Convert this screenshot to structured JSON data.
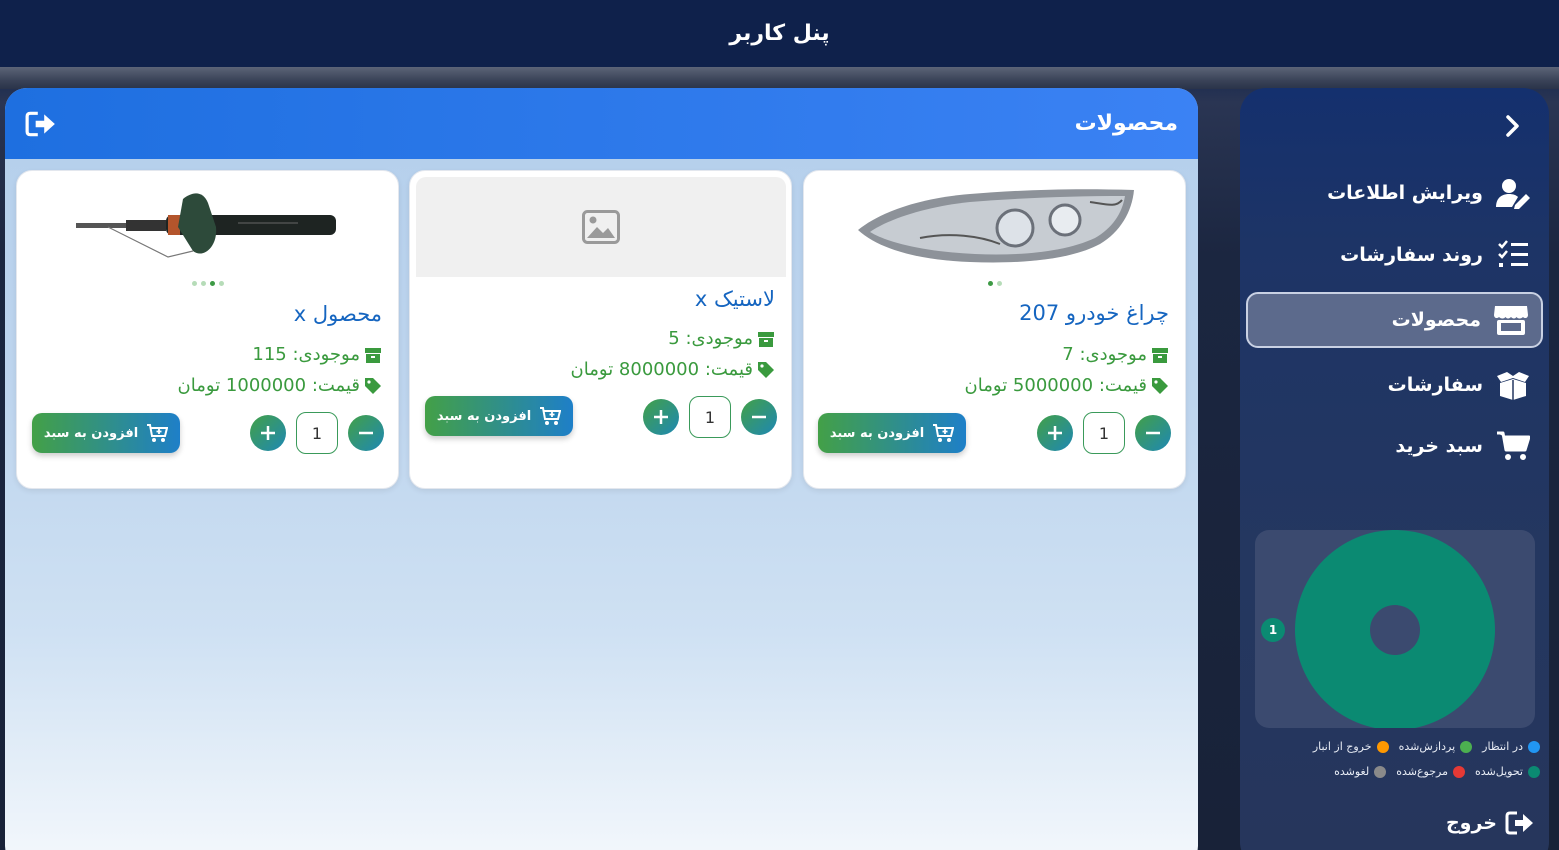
{
  "header": {
    "title": "پنل کاربر"
  },
  "sidebar": {
    "items": [
      {
        "label": "ویرایش اطلاعات",
        "icon": "user-edit-icon"
      },
      {
        "label": "روند سفارشات",
        "icon": "list-check-icon"
      },
      {
        "label": "محصولات",
        "icon": "store-icon",
        "active": true
      },
      {
        "label": "سفارشات",
        "icon": "box-open-icon"
      },
      {
        "label": "سبد خرید",
        "icon": "cart-icon"
      }
    ],
    "chart": {
      "label": "1",
      "legend": [
        {
          "label": "در انتظار",
          "color": "#2196f3"
        },
        {
          "label": "پردازش‌شده",
          "color": "#4caf50"
        },
        {
          "label": "خروج از انبار",
          "color": "#ff9800"
        },
        {
          "label": "تحویل‌شده",
          "color": "#0b8a72"
        },
        {
          "label": "مرجوع‌شده",
          "color": "#e53935"
        },
        {
          "label": "لغوشده",
          "color": "#8a8a8a"
        }
      ]
    },
    "logout_label": "خروج"
  },
  "main": {
    "title": "محصولات",
    "products": [
      {
        "title": "چراغ خودرو 207",
        "stock": "موجودی: 7",
        "price": "قیمت: 5000000 تومان",
        "qty": "1",
        "add_label": "افزودن به سبد",
        "image": "headlight"
      },
      {
        "title": "لاستیک x",
        "stock": "موجودی: 5",
        "price": "قیمت: 8000000 تومان",
        "qty": "1",
        "add_label": "افزودن به سبد",
        "image": "placeholder-image-icon"
      },
      {
        "title": "محصول x",
        "stock": "موجودی: 115",
        "price": "قیمت: 1000000 تومان",
        "qty": "1",
        "add_label": "افزودن به سبد",
        "image": "shock-absorber"
      }
    ]
  },
  "chart_data": {
    "type": "pie",
    "categories": [
      "در انتظار",
      "پردازش‌شده",
      "خروج از انبار",
      "تحویل‌شده",
      "مرجوع‌شده",
      "لغوشده"
    ],
    "values": [
      0,
      0,
      0,
      1,
      0,
      0
    ],
    "donut": true
  }
}
